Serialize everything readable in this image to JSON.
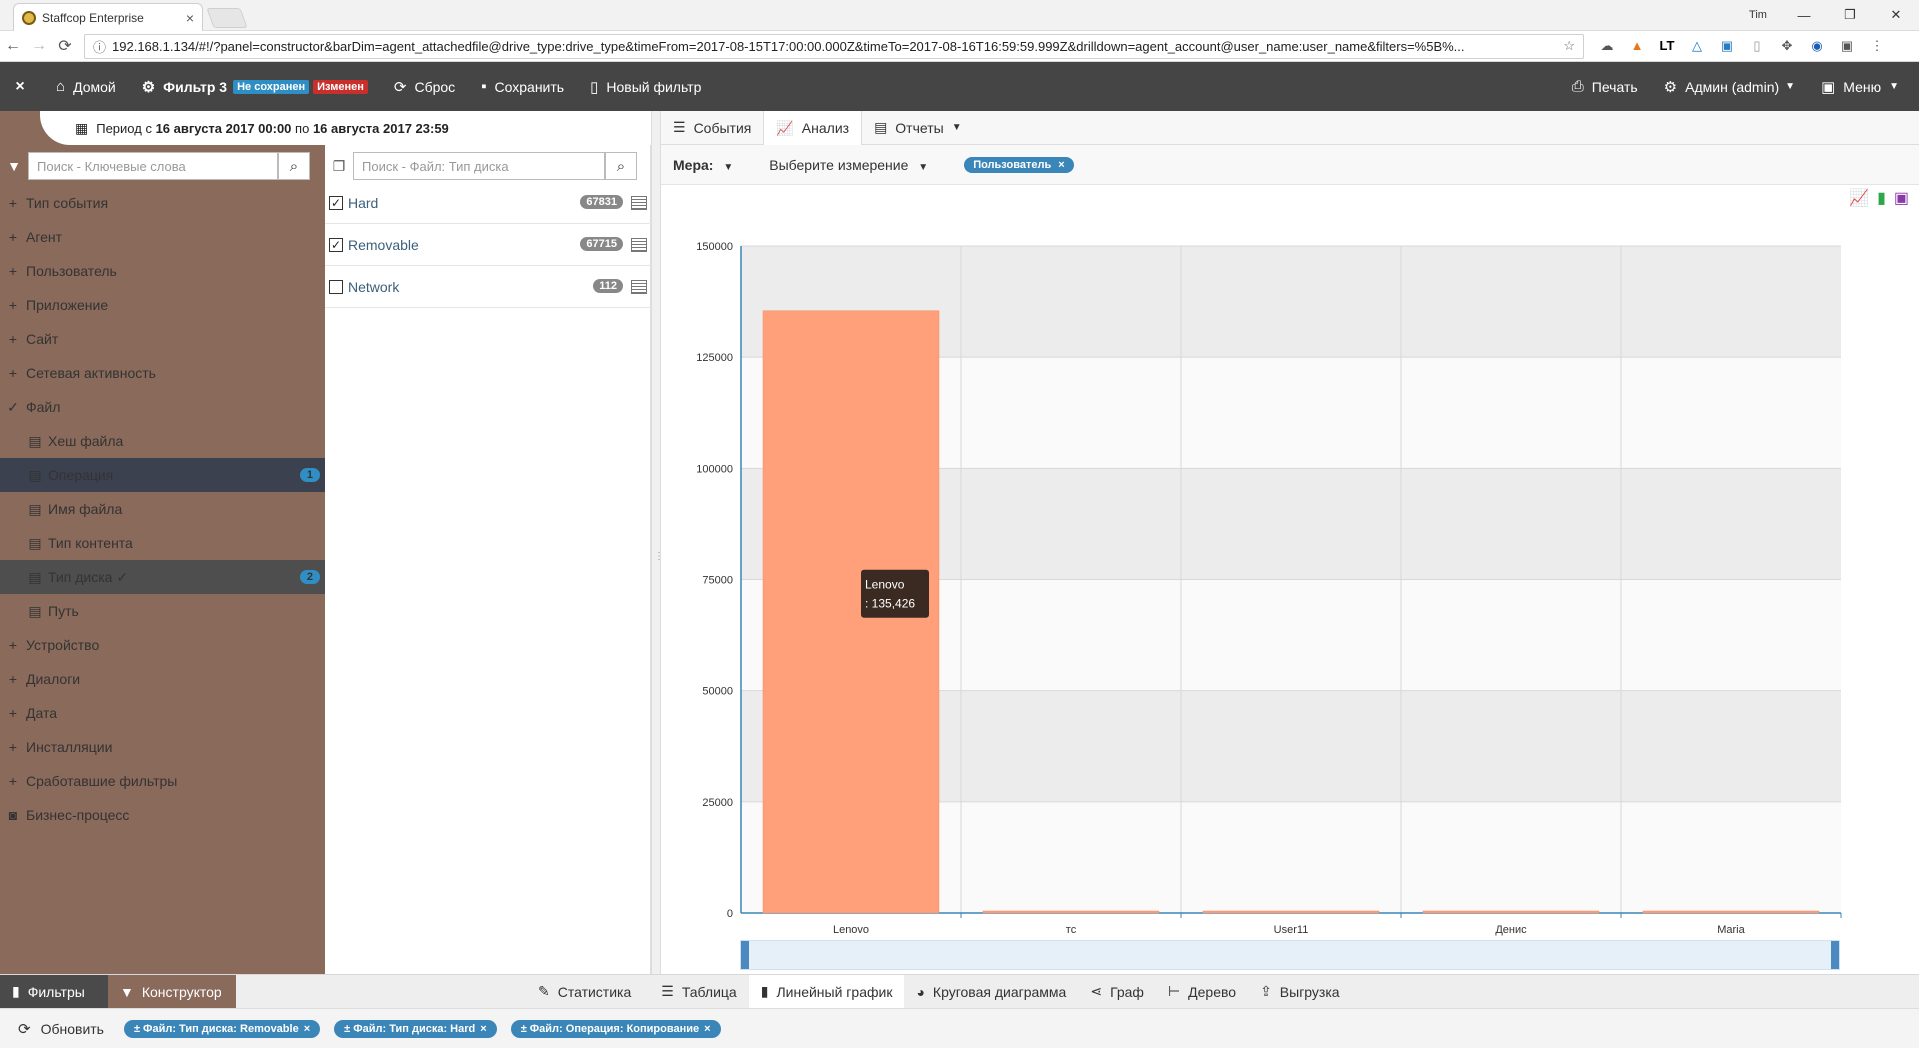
{
  "browser": {
    "tab_title": "Staffcop Enterprise",
    "tab_close": "×",
    "window_user": "Tim",
    "url": "192.168.1.134/#!/?panel=constructor&barDim=agent_attachedfile@drive_type:drive_type&timeFrom=2017-08-15T17:00:00.000Z&timeTo=2017-08-16T16:59:59.999Z&drilldown=agent_account@user_name:user_name&filters=%5B%..."
  },
  "header": {
    "close": "×",
    "home": "Домой",
    "filter_name": "Фильтр 3",
    "badge_unsaved": "Не сохранен",
    "badge_changed": "Изменен",
    "reset": "Сброс",
    "save": "Сохранить",
    "new_filter": "Новый фильтр",
    "print": "Печать",
    "admin": "Админ (admin)",
    "menu": "Меню"
  },
  "period": {
    "prefix": "Период с",
    "from": "16 августа 2017 00:00",
    "mid": "по",
    "to": "16 августа 2017 23:59"
  },
  "sidebar": {
    "search_placeholder": "Поиск - Ключевые слова",
    "items": [
      {
        "icon": "+",
        "label": "Тип события"
      },
      {
        "icon": "+",
        "label": "Агент"
      },
      {
        "icon": "+",
        "label": "Пользователь"
      },
      {
        "icon": "+",
        "label": "Приложение"
      },
      {
        "icon": "+",
        "label": "Сайт"
      },
      {
        "icon": "+",
        "label": "Сетевая активность"
      },
      {
        "icon": "✓",
        "label": "Файл"
      },
      {
        "icon": "▤",
        "label": "Хеш файла"
      },
      {
        "icon": "▤",
        "label": "Операция",
        "count": "1"
      },
      {
        "icon": "▤",
        "label": "Имя файла"
      },
      {
        "icon": "▤",
        "label": "Тип контента"
      },
      {
        "icon": "▤",
        "label": "Тип диска ✓",
        "count": "2"
      },
      {
        "icon": "▤",
        "label": "Путь"
      },
      {
        "icon": "+",
        "label": "Устройство"
      },
      {
        "icon": "+",
        "label": "Диалоги"
      },
      {
        "icon": "+",
        "label": "Дата"
      },
      {
        "icon": "+",
        "label": "Инсталляции"
      },
      {
        "icon": "+",
        "label": "Сработавшие фильтры"
      },
      {
        "icon": "◙",
        "label": "Бизнес-процесс"
      }
    ]
  },
  "middle": {
    "search_placeholder": "Поиск - Файл: Тип диска",
    "rows": [
      {
        "label": "Hard",
        "count": "67831",
        "checked": true
      },
      {
        "label": "Removable",
        "count": "67715",
        "checked": true
      },
      {
        "label": "Network",
        "count": "112",
        "checked": false
      }
    ]
  },
  "main_tabs": {
    "events": "События",
    "analysis": "Анализ",
    "reports": "Отчеты"
  },
  "controls": {
    "measure": "Мера:",
    "dimension": "Выберите измерение",
    "pill": "Пользователь"
  },
  "chart_data": {
    "type": "bar",
    "categories": [
      "Lenovo",
      "тс",
      "User11",
      "Денис",
      "Maria"
    ],
    "values": [
      135426,
      300,
      300,
      300,
      300
    ],
    "ylim": [
      0,
      150000
    ],
    "yticks": [
      "0",
      "25000",
      "50000",
      "75000",
      "100000",
      "125000",
      "150000"
    ],
    "bar_color": "#ffa07a",
    "tooltip": {
      "line1": "Lenovo",
      "line2": ": 135,426"
    },
    "grid": true
  },
  "bottom_tabs": {
    "filters": "Фильтры",
    "constructor": "Конструктор",
    "stats": "Статистика",
    "table": "Таблица",
    "line": "Линейный график",
    "pie": "Круговая диаграмма",
    "graph": "Граф",
    "tree": "Дерево",
    "export": "Выгрузка"
  },
  "footer": {
    "refresh": "Обновить",
    "chips": [
      "± Файл: Тип диска: Removable",
      "± Файл: Тип диска: Hard",
      "± Файл: Операция: Копирование"
    ],
    "chip_close": "×"
  },
  "colors": {
    "header_bg": "#454545",
    "sidebar_bg": "#8a6a5b",
    "accent": "#3a86b8",
    "badge_unsaved": "#2f8fc4",
    "badge_changed": "#c9302c"
  }
}
